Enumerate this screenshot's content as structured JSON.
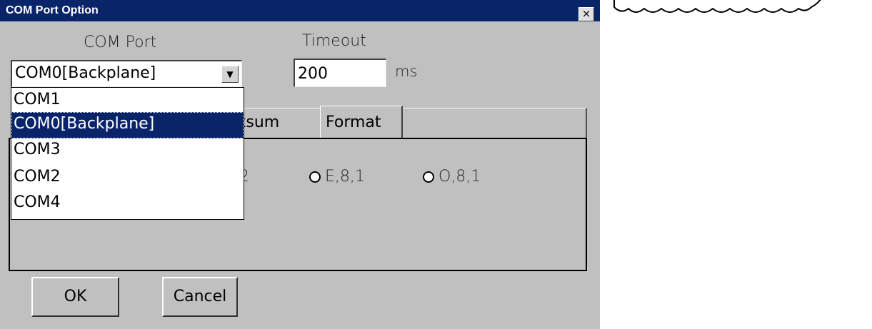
{
  "window": {
    "title": "COM Port Option",
    "close_glyph": "×"
  },
  "com_port": {
    "label": "COM Port",
    "selected": "COM0[Backplane]",
    "dropdown_arrow": "▼",
    "options": [
      "COM1",
      "COM0[Backplane]",
      "COM3",
      "COM2",
      "COM4"
    ],
    "highlighted_index": 1
  },
  "timeout": {
    "label": "Timeout",
    "value": "200",
    "unit": "ms"
  },
  "tabs": [
    {
      "label": "ecksum",
      "active": false
    },
    {
      "label": "Format",
      "active": true
    }
  ],
  "format_options": [
    {
      "label": ",2",
      "checked": false
    },
    {
      "label": "E,8,1",
      "checked": false
    },
    {
      "label": "O,8,1",
      "checked": false
    }
  ],
  "buttons": {
    "ok": "OK",
    "cancel": "Cancel"
  },
  "colors": {
    "titlebar": "#0a246a",
    "dialog_bg": "#c0c0c0",
    "selection": "#0a246a"
  }
}
